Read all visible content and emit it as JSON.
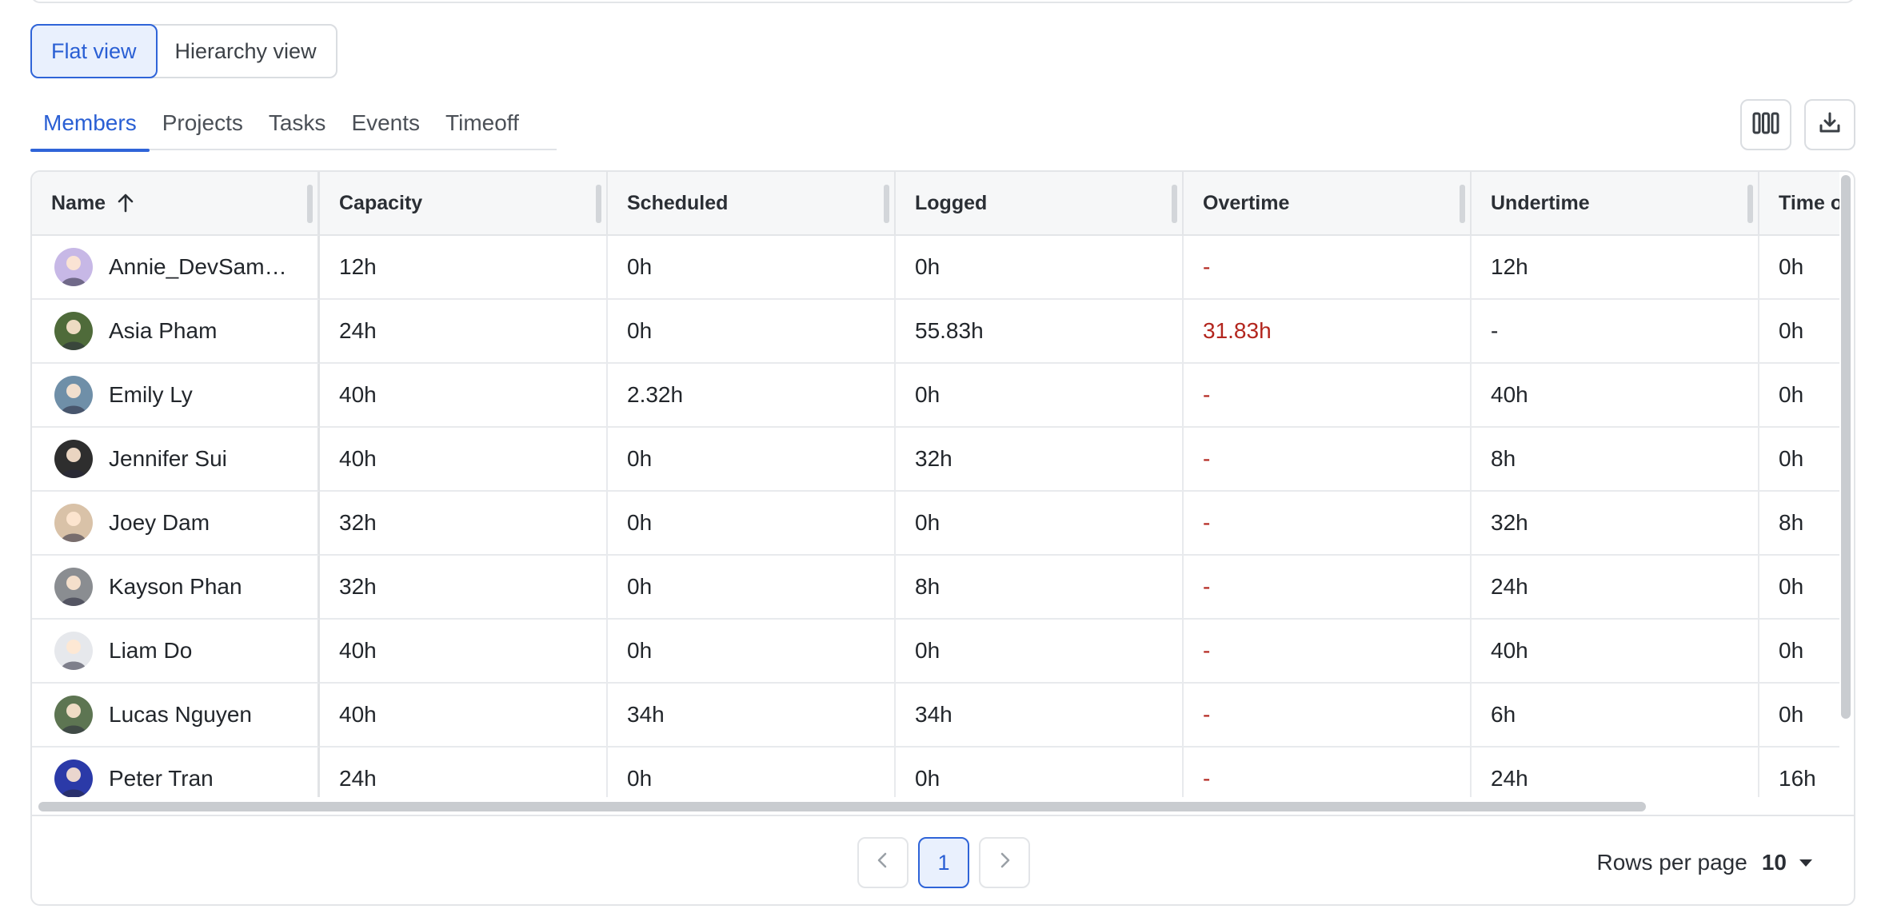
{
  "view_toggle": {
    "flat": "Flat view",
    "hierarchy": "Hierarchy view"
  },
  "tabs": [
    {
      "label": "Members",
      "active": true
    },
    {
      "label": "Projects",
      "active": false
    },
    {
      "label": "Tasks",
      "active": false
    },
    {
      "label": "Events",
      "active": false
    },
    {
      "label": "Timeoff",
      "active": false
    }
  ],
  "toolbar": {
    "columns_icon": "columns-icon",
    "download_icon": "download-icon"
  },
  "table": {
    "columns": [
      "Name",
      "Capacity",
      "Scheduled",
      "Logged",
      "Overtime",
      "Undertime",
      "Time off"
    ],
    "sort": {
      "column": "Name",
      "direction": "ascending"
    },
    "rows": [
      {
        "name": "Annie_DevSampleUser",
        "avatar_color": "#c7b8e6",
        "capacity": "12h",
        "scheduled": "0h",
        "logged": "0h",
        "overtime": "-",
        "overtime_red": true,
        "undertime": "12h",
        "timeoff": "0h"
      },
      {
        "name": "Asia Pham",
        "avatar_color": "#4f6b3a",
        "capacity": "24h",
        "scheduled": "0h",
        "logged": "55.83h",
        "overtime": "31.83h",
        "overtime_red": true,
        "undertime": "-",
        "timeoff": "0h"
      },
      {
        "name": "Emily Ly",
        "avatar_color": "#6f8fa8",
        "capacity": "40h",
        "scheduled": "2.32h",
        "logged": "0h",
        "overtime": "-",
        "overtime_red": true,
        "undertime": "40h",
        "timeoff": "0h"
      },
      {
        "name": "Jennifer Sui",
        "avatar_color": "#2e2e2e",
        "capacity": "40h",
        "scheduled": "0h",
        "logged": "32h",
        "overtime": "-",
        "overtime_red": true,
        "undertime": "8h",
        "timeoff": "0h"
      },
      {
        "name": "Joey Dam",
        "avatar_color": "#d9c2a8",
        "capacity": "32h",
        "scheduled": "0h",
        "logged": "0h",
        "overtime": "-",
        "overtime_red": true,
        "undertime": "32h",
        "timeoff": "8h"
      },
      {
        "name": "Kayson Phan",
        "avatar_color": "#8a8d91",
        "capacity": "32h",
        "scheduled": "0h",
        "logged": "8h",
        "overtime": "-",
        "overtime_red": true,
        "undertime": "24h",
        "timeoff": "0h"
      },
      {
        "name": "Liam Do",
        "avatar_color": "#e6e8ec",
        "capacity": "40h",
        "scheduled": "0h",
        "logged": "0h",
        "overtime": "-",
        "overtime_red": true,
        "undertime": "40h",
        "timeoff": "0h"
      },
      {
        "name": "Lucas Nguyen",
        "avatar_color": "#5d7552",
        "capacity": "40h",
        "scheduled": "34h",
        "logged": "34h",
        "overtime": "-",
        "overtime_red": true,
        "undertime": "6h",
        "timeoff": "0h"
      },
      {
        "name": "Peter Tran",
        "avatar_color": "#2b3aa8",
        "capacity": "24h",
        "scheduled": "0h",
        "logged": "0h",
        "overtime": "-",
        "overtime_red": true,
        "undertime": "24h",
        "timeoff": "16h"
      }
    ]
  },
  "pagination": {
    "current_page": "1",
    "rows_per_page_label": "Rows per page",
    "rows_per_page_value": "10"
  },
  "colors": {
    "accent": "#2f64d8",
    "accent_bg": "#e9f0fd",
    "overtime_red": "#b3261e"
  }
}
